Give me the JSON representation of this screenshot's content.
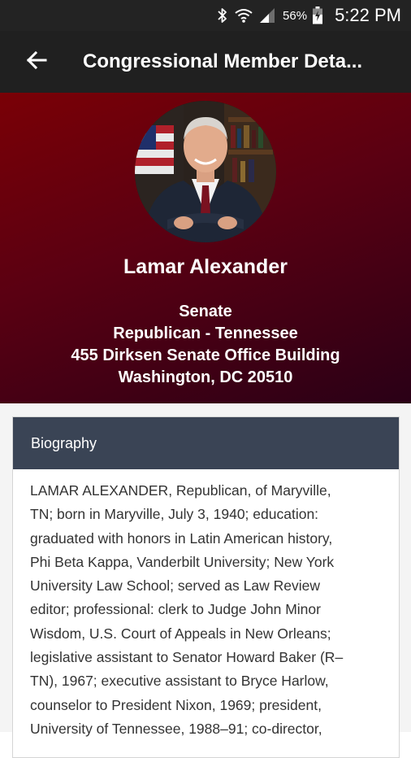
{
  "status_bar": {
    "battery": "56%",
    "time": "5:22 PM",
    "icons": [
      "bluetooth-icon",
      "wifi-icon",
      "signal-icon",
      "battery-icon"
    ]
  },
  "app_bar": {
    "title": "Congressional Member Deta...",
    "back_icon": "arrow-left-icon"
  },
  "member": {
    "name": "Lamar Alexander",
    "chamber": "Senate",
    "party_state": "Republican - Tennessee",
    "office": "455 Dirksen Senate Office Building",
    "city": "Washington, DC 20510"
  },
  "biography": {
    "header": "Biography",
    "lines": [
      "LAMAR ALEXANDER, Republican, of Maryville,",
      "TN; born in Maryville, July 3, 1940; education:",
      "graduated with honors in Latin American history,",
      "Phi Beta Kappa, Vanderbilt University; New York",
      "University Law School; served as Law Review",
      "editor; professional: clerk to Judge John Minor",
      "Wisdom, U.S. Court of Appeals in New Orleans;",
      "legislative assistant to Senator Howard Baker (R–",
      "TN), 1967; executive assistant to Bryce Harlow,",
      "counselor to President Nixon, 1969; president,",
      "University of Tennessee, 1988–91; co-director,"
    ]
  },
  "colors": {
    "status_bar": "#232323",
    "app_bar": "#202020",
    "hero_start": "#7a0006",
    "hero_end": "#2a0016",
    "card_header": "#3a4455"
  }
}
